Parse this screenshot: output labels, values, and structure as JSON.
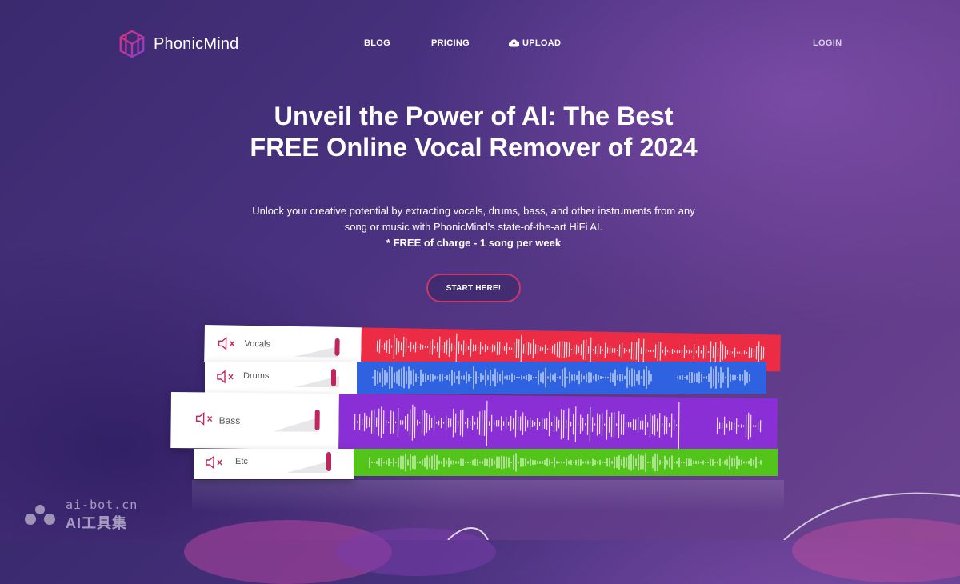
{
  "brand": {
    "name": "PhonicMind",
    "logo_icon": "phonicmind-logo-icon"
  },
  "nav": {
    "blog": "BLOG",
    "pricing": "PRICING",
    "upload": "UPLOAD",
    "upload_icon": "cloud-upload-icon",
    "login": "LOGIN"
  },
  "hero": {
    "title": "Unveil the Power of AI: The Best FREE Online Vocal Remover of 2024",
    "subtitle": "Unlock your creative potential by extracting vocals, drums, bass, and other instruments from any song or music with PhonicMind's state-of-the-art HiFi AI.",
    "free_note": "* FREE of charge - 1 song per week",
    "cta": "START HERE!"
  },
  "tracks": [
    {
      "label": "Vocals",
      "color": "#ec2b45",
      "icon": "muted-speaker-icon"
    },
    {
      "label": "Drums",
      "color": "#2f62e0",
      "icon": "muted-speaker-icon"
    },
    {
      "label": "Bass",
      "color": "#8a2ed6",
      "icon": "muted-speaker-icon"
    },
    {
      "label": "Etc",
      "color": "#52c41a",
      "icon": "muted-speaker-icon"
    }
  ],
  "watermark": {
    "line1": "ai-bot.cn",
    "line2": "AI工具集"
  },
  "colors": {
    "accent": "#c2245e",
    "cta_border": "#c9386a",
    "background": "#4a3280"
  }
}
